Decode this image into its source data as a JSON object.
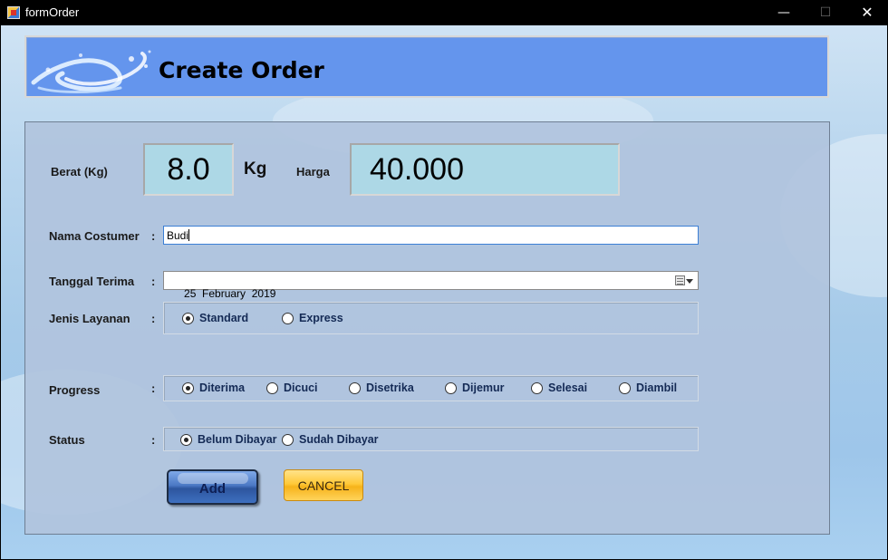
{
  "window": {
    "title": "formOrder",
    "minimize_glyph": "—",
    "maximize_glyph": "☐",
    "close_glyph": "✕"
  },
  "header": {
    "title": "Create Order",
    "logo_icon": "water-splash-icon"
  },
  "weight": {
    "label": "Berat (Kg)",
    "value": "8.0",
    "unit": "Kg"
  },
  "price": {
    "label": "Harga",
    "value": "40.000"
  },
  "customer": {
    "label": "Nama Costumer",
    "colon": ":",
    "value": "Budi"
  },
  "date_received": {
    "label": "Tanggal Terima",
    "colon": ":",
    "value": "25  February  2019"
  },
  "service_type": {
    "label": "Jenis Layanan",
    "colon": ":",
    "options": [
      {
        "label": "Standard",
        "selected": true
      },
      {
        "label": "Express",
        "selected": false
      }
    ]
  },
  "progress": {
    "label": "Progress",
    "colon": ":",
    "options": [
      {
        "label": "Diterima",
        "selected": true
      },
      {
        "label": "Dicuci",
        "selected": false
      },
      {
        "label": "Disetrika",
        "selected": false
      },
      {
        "label": "Dijemur",
        "selected": false
      },
      {
        "label": "Selesai",
        "selected": false
      },
      {
        "label": "Diambil",
        "selected": false
      }
    ]
  },
  "status": {
    "label": "Status",
    "colon": ":",
    "options": [
      {
        "label": "Belum Dibayar",
        "selected": true
      },
      {
        "label": "Sudah Dibayar",
        "selected": false
      }
    ]
  },
  "buttons": {
    "add_label": "Add",
    "cancel_label": "CANCEL"
  },
  "colors": {
    "header_bg": "#6495ed",
    "panel_bg": "#b0c4de",
    "display_bg": "#add8e6",
    "radio_text": "#142a55"
  }
}
